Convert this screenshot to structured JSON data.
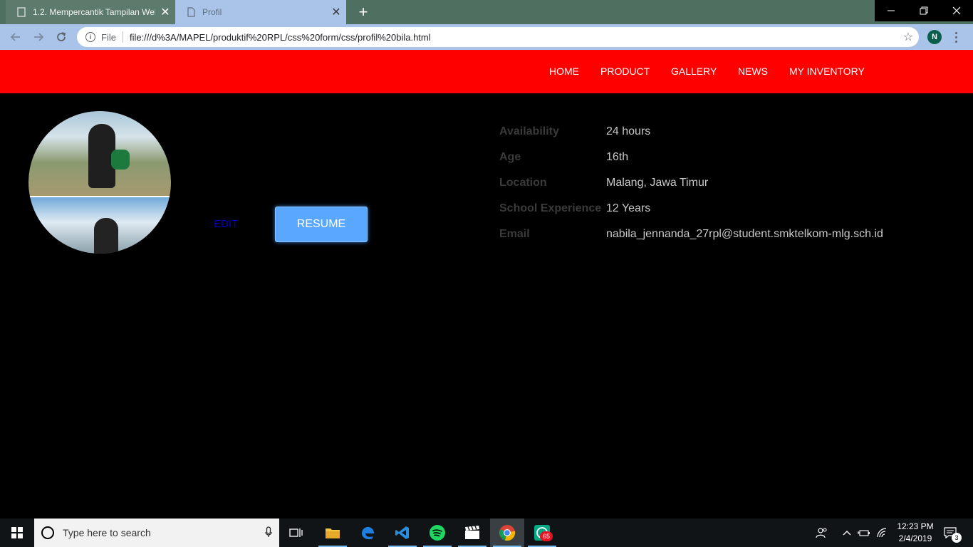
{
  "browser": {
    "tabs": [
      {
        "title": "1.2. Mempercantik Tampilan Web",
        "active": false
      },
      {
        "title": "Profil",
        "active": true
      }
    ],
    "new_tab_label": "+",
    "address": {
      "scheme_label": "File",
      "url": "file:///d%3A/MAPEL/produktif%20RPL/css%20form/css/profil%20bila.html"
    },
    "profile_initial": "N"
  },
  "nav": {
    "items": [
      "HOME",
      "PRODUCT",
      "GALLERY",
      "NEWS",
      "MY INVENTORY"
    ]
  },
  "profile": {
    "edit_label": "EDIT",
    "resume_label": "RESUME",
    "info": [
      {
        "label": "Availability",
        "value": "24 hours"
      },
      {
        "label": "Age",
        "value": "16th"
      },
      {
        "label": "Location",
        "value": "Malang, Jawa Timur"
      },
      {
        "label": "School Experience",
        "value": "12 Years"
      },
      {
        "label": "Email",
        "value": "nabila_jennanda_27rpl@student.smktelkom-mlg.sch.id"
      }
    ]
  },
  "taskbar": {
    "search_placeholder": "Type here to search",
    "clock_time": "12:23 PM",
    "clock_date": "2/4/2019",
    "notification_count": "3",
    "whatsapp_badge": "65"
  },
  "colors": {
    "navbar_bg": "#ff0000",
    "resume_bg": "#5aa7ff",
    "edit_link": "#0000cc"
  }
}
